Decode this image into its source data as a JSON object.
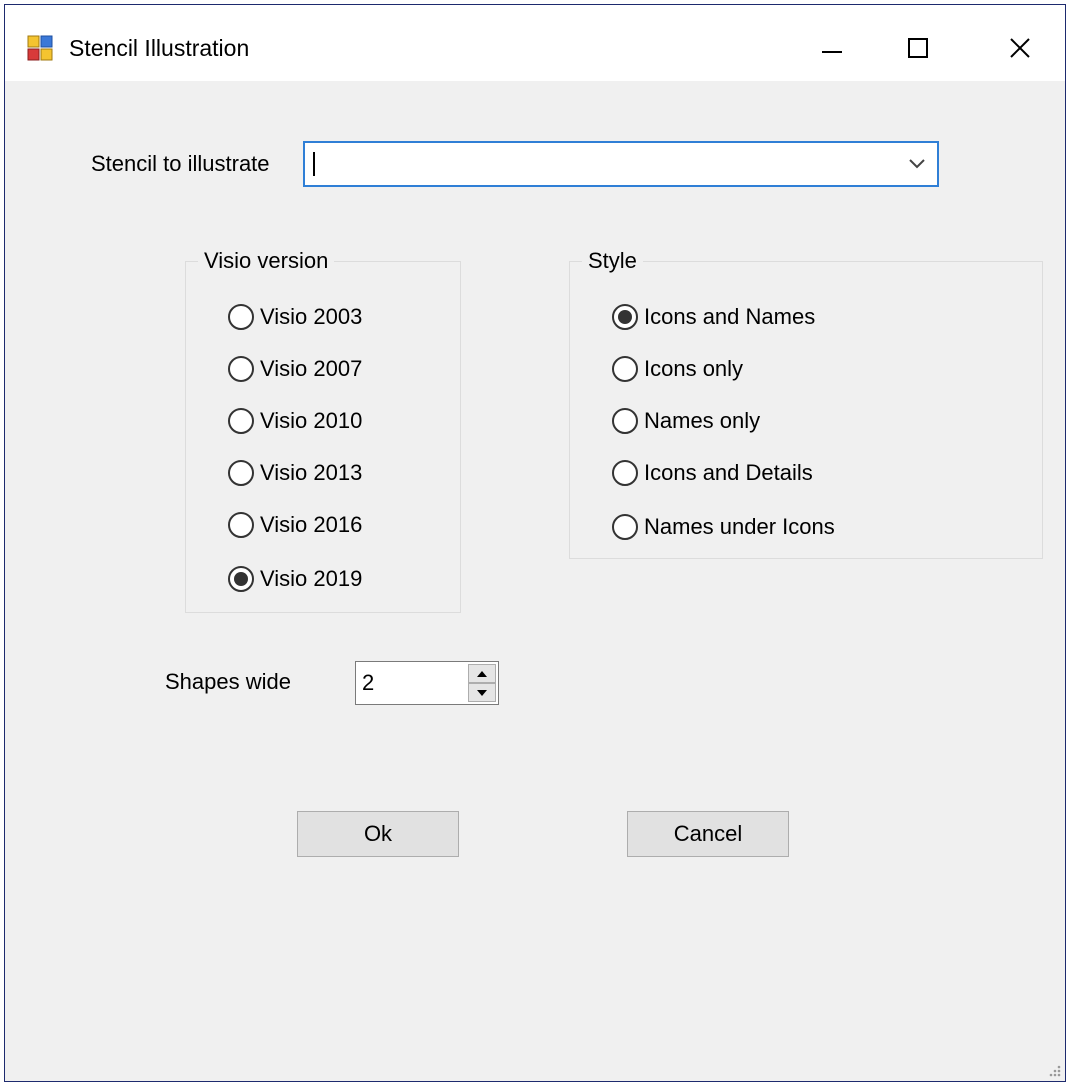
{
  "window": {
    "title": "Stencil Illustration",
    "icon": "form-app-icon",
    "controls": [
      "minimize-icon",
      "maximize-icon",
      "close-icon"
    ]
  },
  "stencil": {
    "label": "Stencil to illustrate",
    "value": ""
  },
  "visio_version": {
    "title": "Visio version",
    "options": [
      {
        "label": "Visio 2003",
        "checked": false
      },
      {
        "label": "Visio 2007",
        "checked": false
      },
      {
        "label": "Visio 2010",
        "checked": false
      },
      {
        "label": "Visio 2013",
        "checked": false
      },
      {
        "label": "Visio 2016",
        "checked": false
      },
      {
        "label": "Visio 2019",
        "checked": true
      }
    ]
  },
  "style": {
    "title": "Style",
    "options": [
      {
        "label": "Icons and Names",
        "checked": true
      },
      {
        "label": "Icons only",
        "checked": false
      },
      {
        "label": "Names only",
        "checked": false
      },
      {
        "label": "Icons and Details",
        "checked": false
      },
      {
        "label": "Names under Icons",
        "checked": false
      }
    ]
  },
  "shapes_wide": {
    "label": "Shapes wide",
    "value": "2"
  },
  "buttons": {
    "ok": "Ok",
    "cancel": "Cancel"
  },
  "colors": {
    "accent": "#2f7fd6",
    "window_border": "#1d2a6e",
    "background": "#f0f0f0"
  }
}
